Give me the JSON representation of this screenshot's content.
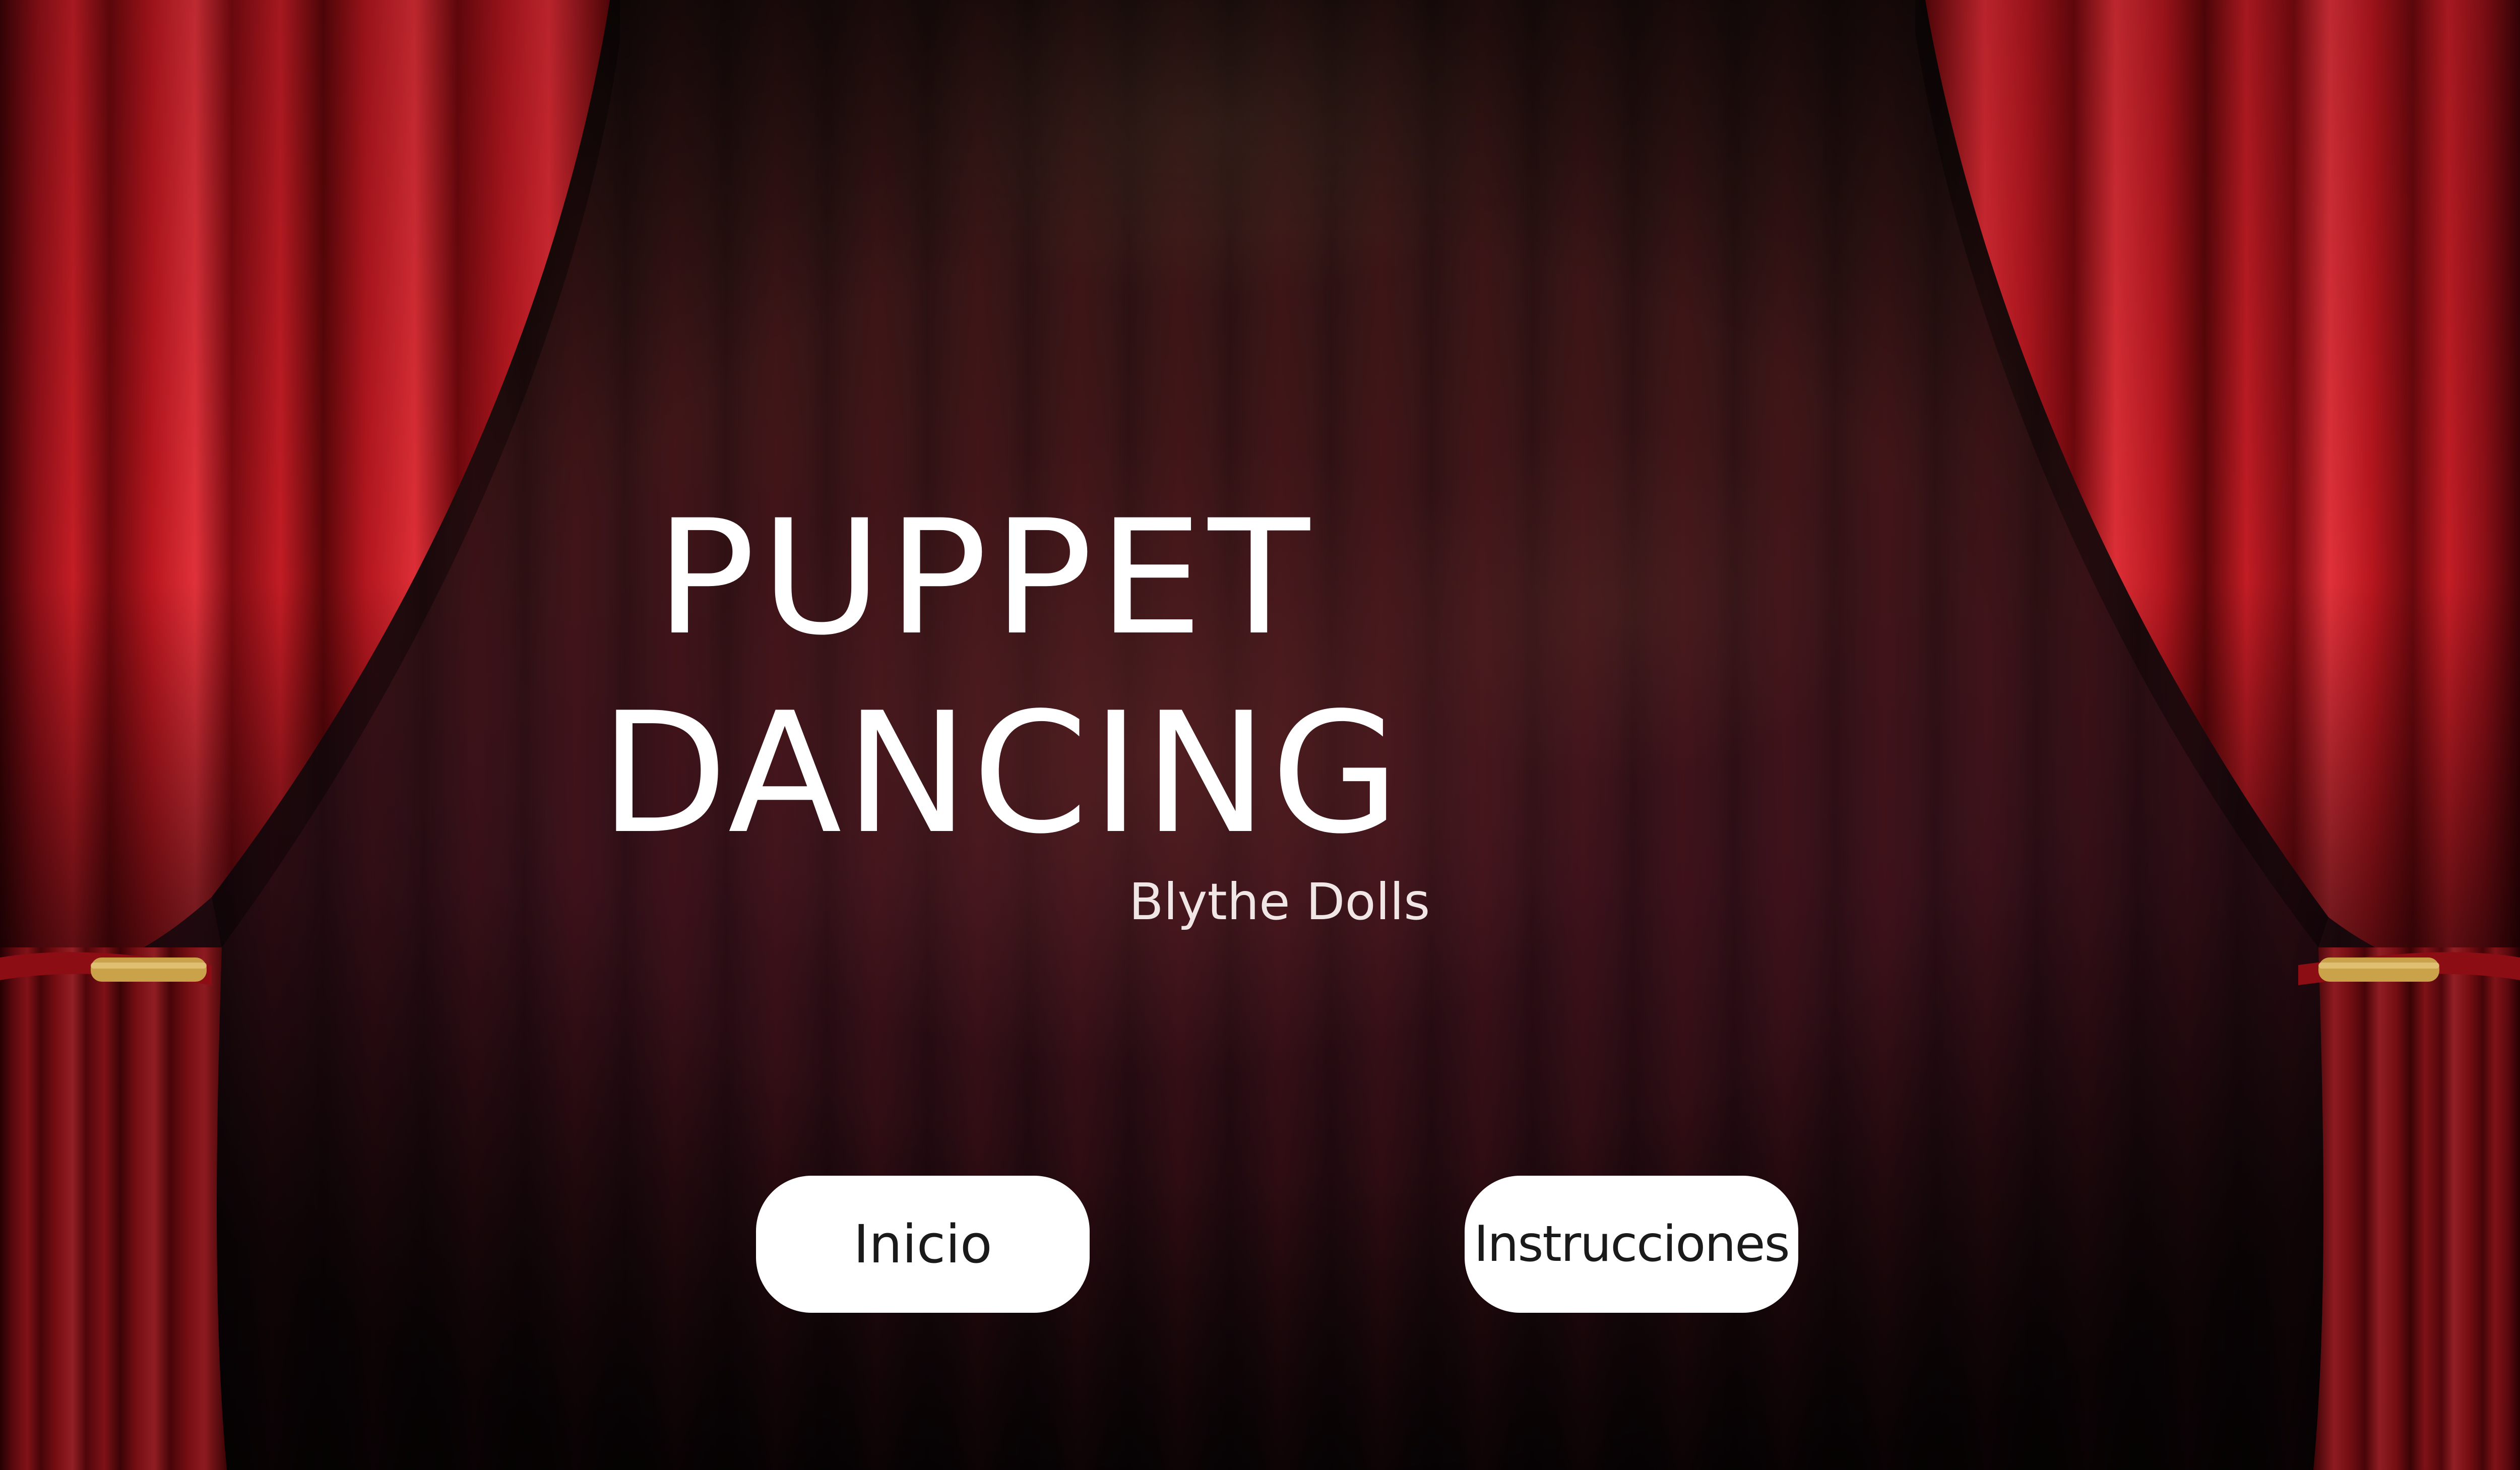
{
  "title": {
    "line1": "PUPPET",
    "line2": "DANCING"
  },
  "subtitle": "Blythe Dolls",
  "buttons": {
    "start_label": "Inicio",
    "instructions_label": "Instrucciones"
  },
  "colors": {
    "curtain_red": "#b8161e",
    "curtain_dark": "#4a0508",
    "tieback_gold": "#c9a24a",
    "button_bg": "#ffffff",
    "title_text": "#ffffff"
  }
}
